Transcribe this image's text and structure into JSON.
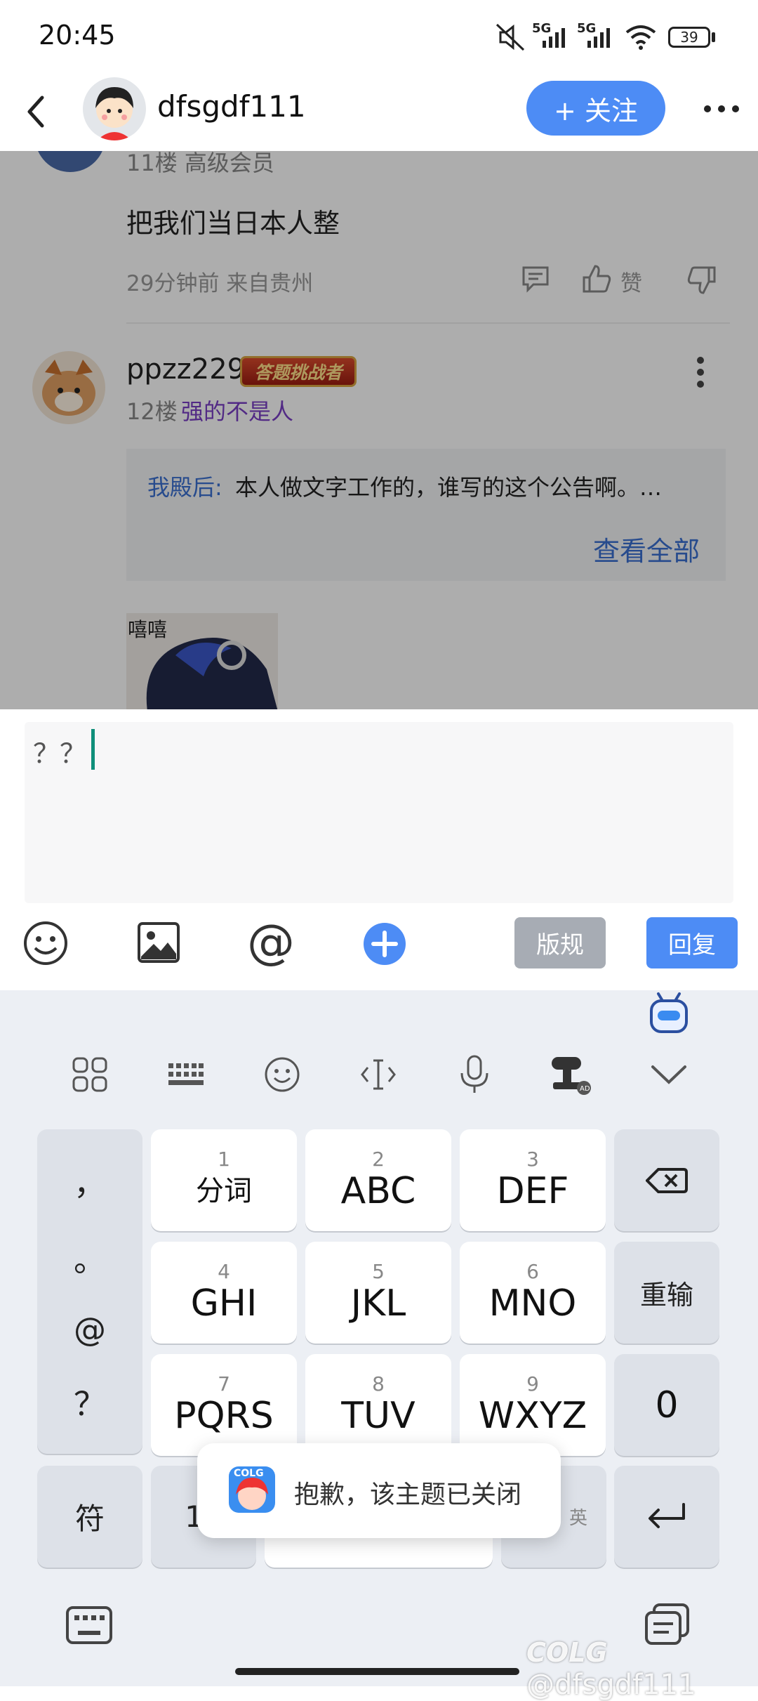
{
  "status_bar": {
    "time": "20:45",
    "net1": "5G",
    "net2": "5G",
    "battery": "39"
  },
  "header": {
    "username": "dfsgdf111",
    "follow_label": "+ 关注"
  },
  "feed": {
    "post11": {
      "floor_line": "11楼  高级会员",
      "content": "把我们当日本人整",
      "meta": "29分钟前 来自贵州",
      "like_label": "赞"
    },
    "post12": {
      "username": "ppzz229",
      "badge": "答题挑战者",
      "floor": "12楼",
      "title": "强的不是人",
      "quote_author": "我殿后:",
      "quote_text": "本人做文字工作的，谁写的这个公告啊。…",
      "view_all": "查看全部",
      "sticker_text": "嘻嘻"
    }
  },
  "composer": {
    "input_value": "？？",
    "rules_label": "版规",
    "reply_label": "回复"
  },
  "keyboard": {
    "left_col": [
      "，",
      "。",
      "@",
      "？"
    ],
    "keys": [
      {
        "num": "1",
        "label": "分词"
      },
      {
        "num": "2",
        "label": "ABC"
      },
      {
        "num": "3",
        "label": "DEF"
      },
      {
        "num": "4",
        "label": "GHI"
      },
      {
        "num": "5",
        "label": "JKL"
      },
      {
        "num": "6",
        "label": "MNO"
      },
      {
        "num": "7",
        "label": "PQRS"
      },
      {
        "num": "8",
        "label": "TUV"
      },
      {
        "num": "9",
        "label": "WXYZ"
      }
    ],
    "reset_label": "重输",
    "zero_label": "0",
    "symbol_label": "符",
    "num_label": "12",
    "lang_label": "英"
  },
  "toast": {
    "text": "抱歉，该主题已关闭",
    "logo_text": "COLG"
  },
  "watermark": {
    "text": "@dfsgdf111",
    "brand": "COLG"
  },
  "colors": {
    "accent": "#4d8cf5",
    "purple": "#7a3fc5",
    "cursor": "#0f8f7a"
  }
}
